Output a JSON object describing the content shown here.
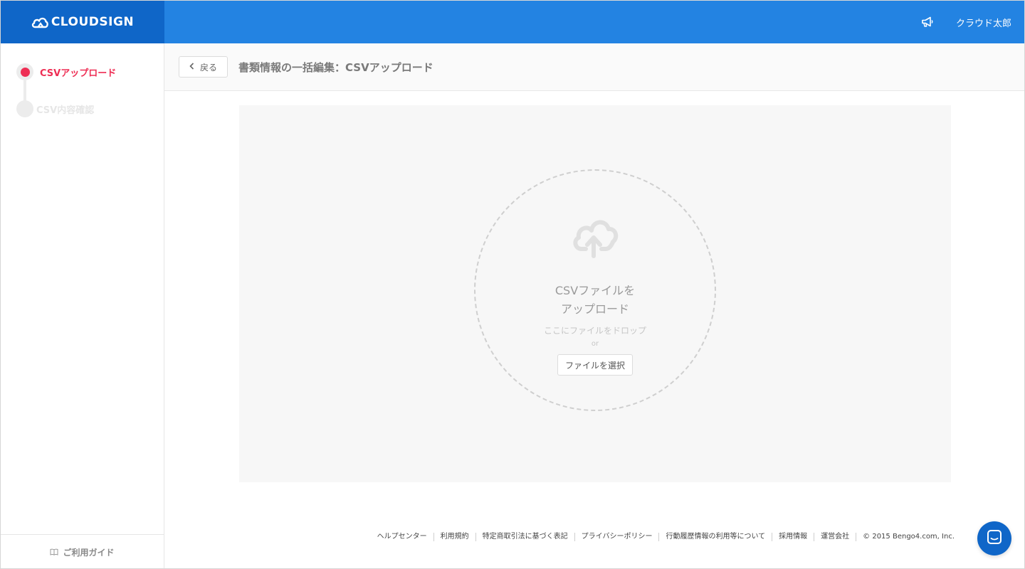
{
  "header": {
    "logo_text": "CLOUDSIGN",
    "user_name": "クラウド太郎",
    "icons": {
      "announcement": "megaphone-icon",
      "logo": "cloud-logo-icon"
    },
    "colors": {
      "bar": "#2383e2",
      "logo_bg": "#0f66c8"
    }
  },
  "sidebar": {
    "steps": [
      {
        "label": "CSVアップロード",
        "state": "active"
      },
      {
        "label": "CSV内容確認",
        "state": "inactive"
      }
    ],
    "guide_label": "ご利用ガイド",
    "guide_icon": "book-icon",
    "accent_color": "#ee2e54"
  },
  "page": {
    "back_label": "戻る",
    "title": "書類情報の一括編集：CSVアップロード"
  },
  "upload": {
    "title_line1": "CSVファイルを",
    "title_line2": "アップロード",
    "drop_hint": "ここにファイルをドロップ",
    "or_text": "or",
    "select_button": "ファイルを選択",
    "icon": "cloud-upload-icon"
  },
  "footer": {
    "links": [
      "ヘルプセンター",
      "利用規約",
      "特定商取引法に基づく表記",
      "プライバシーポリシー",
      "行動履歴情報の利用等について",
      "採用情報",
      "運営会社"
    ],
    "copyright": "© 2015 Bengo4.com, Inc."
  },
  "chat": {
    "icon": "chat-icon"
  }
}
